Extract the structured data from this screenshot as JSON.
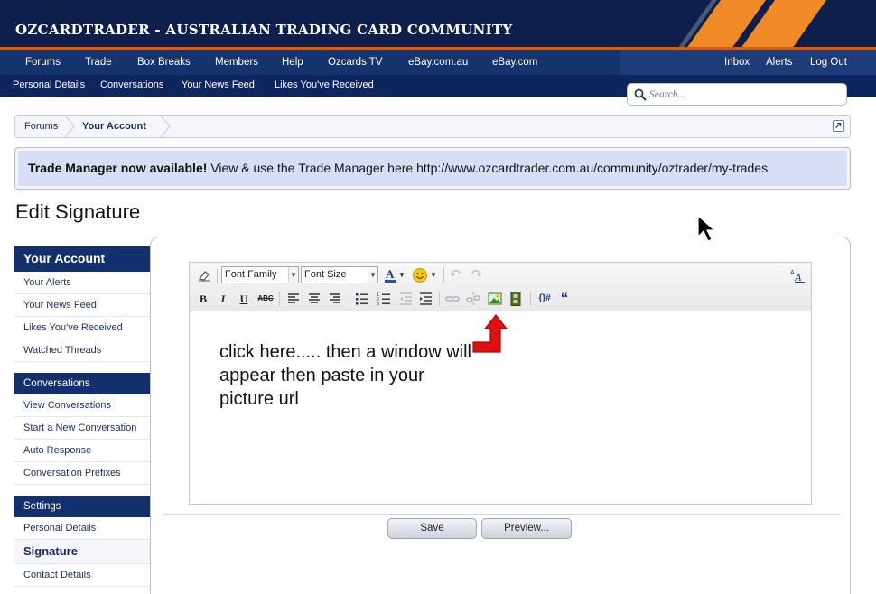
{
  "header": {
    "site_title": "OZCARDTRADER - AUSTRALIAN TRADING CARD COMMUNITY"
  },
  "nav": {
    "tabs": [
      "Forums",
      "Trade",
      "Box Breaks",
      "Members",
      "Help",
      "Ozcards TV",
      "eBay.com.au",
      "eBay.com"
    ],
    "right": [
      "Inbox",
      "Alerts",
      "Log Out"
    ]
  },
  "subnav": {
    "links": [
      "Personal Details",
      "Conversations",
      "Your News Feed",
      "Likes You've Received"
    ]
  },
  "search": {
    "placeholder": "Search..."
  },
  "breadcrumb": {
    "items": [
      "Forums",
      "Your Account"
    ]
  },
  "notice": {
    "bold": "Trade Manager now available!",
    "text": "View & use the Trade Manager here http://www.ozcardtrader.com.au/community/oztrader/my-trades"
  },
  "page_title": "Edit Signature",
  "sidebar": {
    "account_heading": "Your Account",
    "account_items": [
      "Your Alerts",
      "Your News Feed",
      "Likes You've Received",
      "Watched Threads"
    ],
    "conversations_heading": "Conversations",
    "conversations_items": [
      "View Conversations",
      "Start a New Conversation",
      "Auto Response",
      "Conversation Prefixes"
    ],
    "settings_heading": "Settings",
    "settings_items": [
      "Personal Details",
      "Signature",
      "Contact Details"
    ]
  },
  "editor": {
    "font_family": "Font Family",
    "font_size": "Font Size",
    "instruction": "click here..... then a window will appear then paste in your picture url"
  },
  "buttons": {
    "save": "Save",
    "preview": "Preview..."
  },
  "colors": {
    "header_bg": "#0d1f4a",
    "nav_bg": "#15346e",
    "accent_orange": "#f08a24",
    "notice_bg": "#d9def7",
    "arrow_red": "#e01010"
  }
}
